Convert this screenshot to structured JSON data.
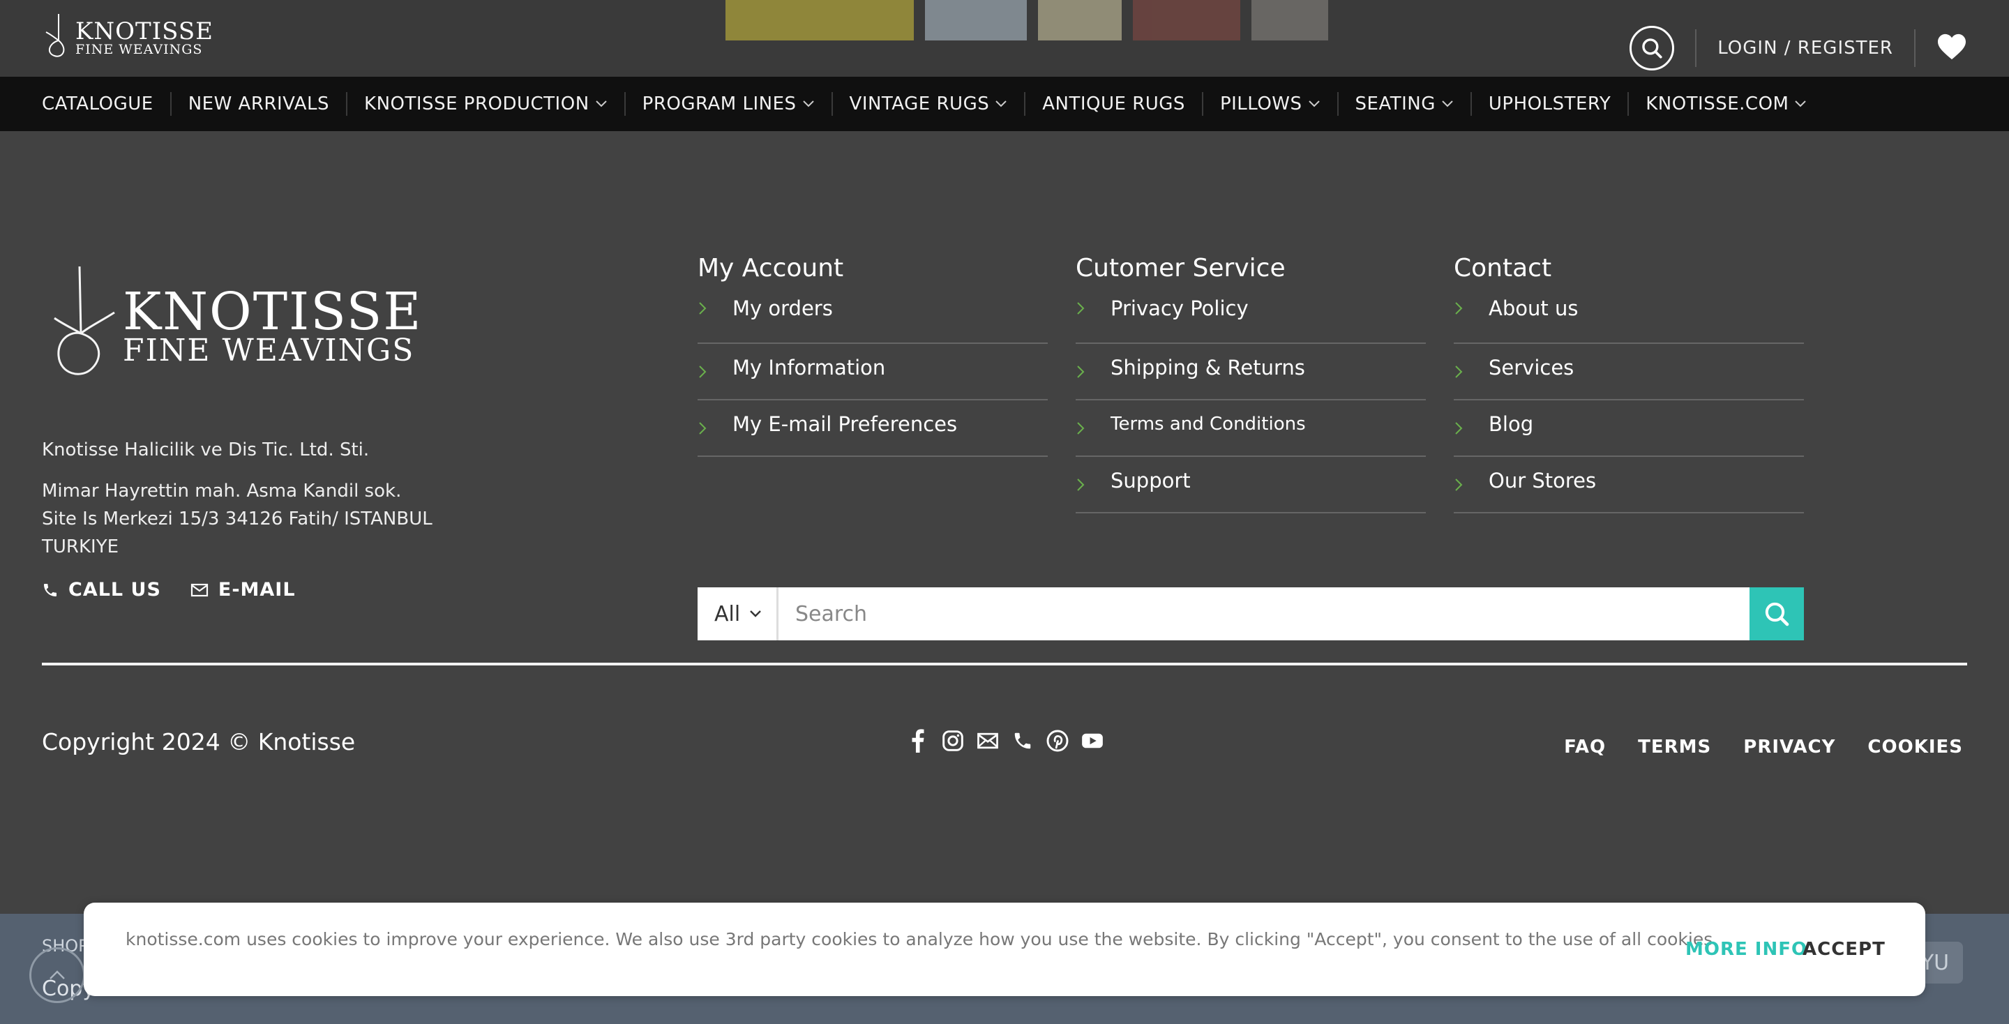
{
  "header": {
    "logo_line1": "KNOTISSE",
    "logo_line2": "FINE WEAVINGS",
    "login_label": "LOGIN / REGISTER"
  },
  "nav": {
    "items": [
      {
        "label": "CATALOGUE",
        "has_dropdown": false
      },
      {
        "label": "NEW ARRIVALS",
        "has_dropdown": false
      },
      {
        "label": "KNOTISSE PRODUCTION",
        "has_dropdown": true
      },
      {
        "label": "PROGRAM LINES",
        "has_dropdown": true
      },
      {
        "label": "VINTAGE RUGS",
        "has_dropdown": true
      },
      {
        "label": "ANTIQUE RUGS",
        "has_dropdown": false
      },
      {
        "label": "PILLOWS",
        "has_dropdown": true
      },
      {
        "label": "SEATING",
        "has_dropdown": true
      },
      {
        "label": "UPHOLSTERY",
        "has_dropdown": false
      },
      {
        "label": "KNOTISSE.COM",
        "has_dropdown": true
      }
    ]
  },
  "footer": {
    "brand_line1": "KNOTISSE",
    "brand_line2": "FINE WEAVINGS",
    "company": "Knotisse Halicilik ve Dis Tic. Ltd. Sti.",
    "address": [
      "Mimar Hayrettin mah. Asma Kandil sok.",
      "Site Is Merkezi 15/3 34126 Fatih/ ISTANBUL",
      "TURKIYE"
    ],
    "call_label": "CALL US",
    "email_label": "E-MAIL",
    "columns": [
      {
        "title": "My Account",
        "links": [
          "My orders",
          "My Information",
          "My E-mail Preferences"
        ]
      },
      {
        "title": "Cutomer Service",
        "links": [
          "Privacy Policy",
          "Shipping & Returns",
          "Terms and Conditions",
          "Support"
        ]
      },
      {
        "title": "Contact",
        "links": [
          "About us",
          "Services",
          "Blog",
          "Our Stores"
        ]
      }
    ],
    "search": {
      "category": "All",
      "placeholder": "Search"
    },
    "copyright": "Copyright 2024 © Knotisse",
    "socials": [
      "facebook-icon",
      "instagram-icon",
      "email-icon",
      "phone-icon",
      "pinterest-icon",
      "youtube-icon"
    ],
    "legal_links": [
      "FAQ",
      "TERMS",
      "PRIVACY",
      "COOKIES"
    ]
  },
  "bottom_strip": {
    "ghost_text_1": "SHOP",
    "ghost_text_2": "Copyri",
    "badge": "YU"
  },
  "cookie_banner": {
    "message": "knotisse.com uses cookies to improve your experience. We also use 3rd party cookies to analyze how you use the website. By clicking \"Accept\", you consent to the use of all cookies.",
    "more_info": "MORE INFO",
    "accept": "ACCEPT"
  },
  "colors": {
    "accent": "#2ec4b6",
    "arrow_green": "#6ab04c",
    "footer_bg": "#424242",
    "nav_bg": "#101010"
  }
}
